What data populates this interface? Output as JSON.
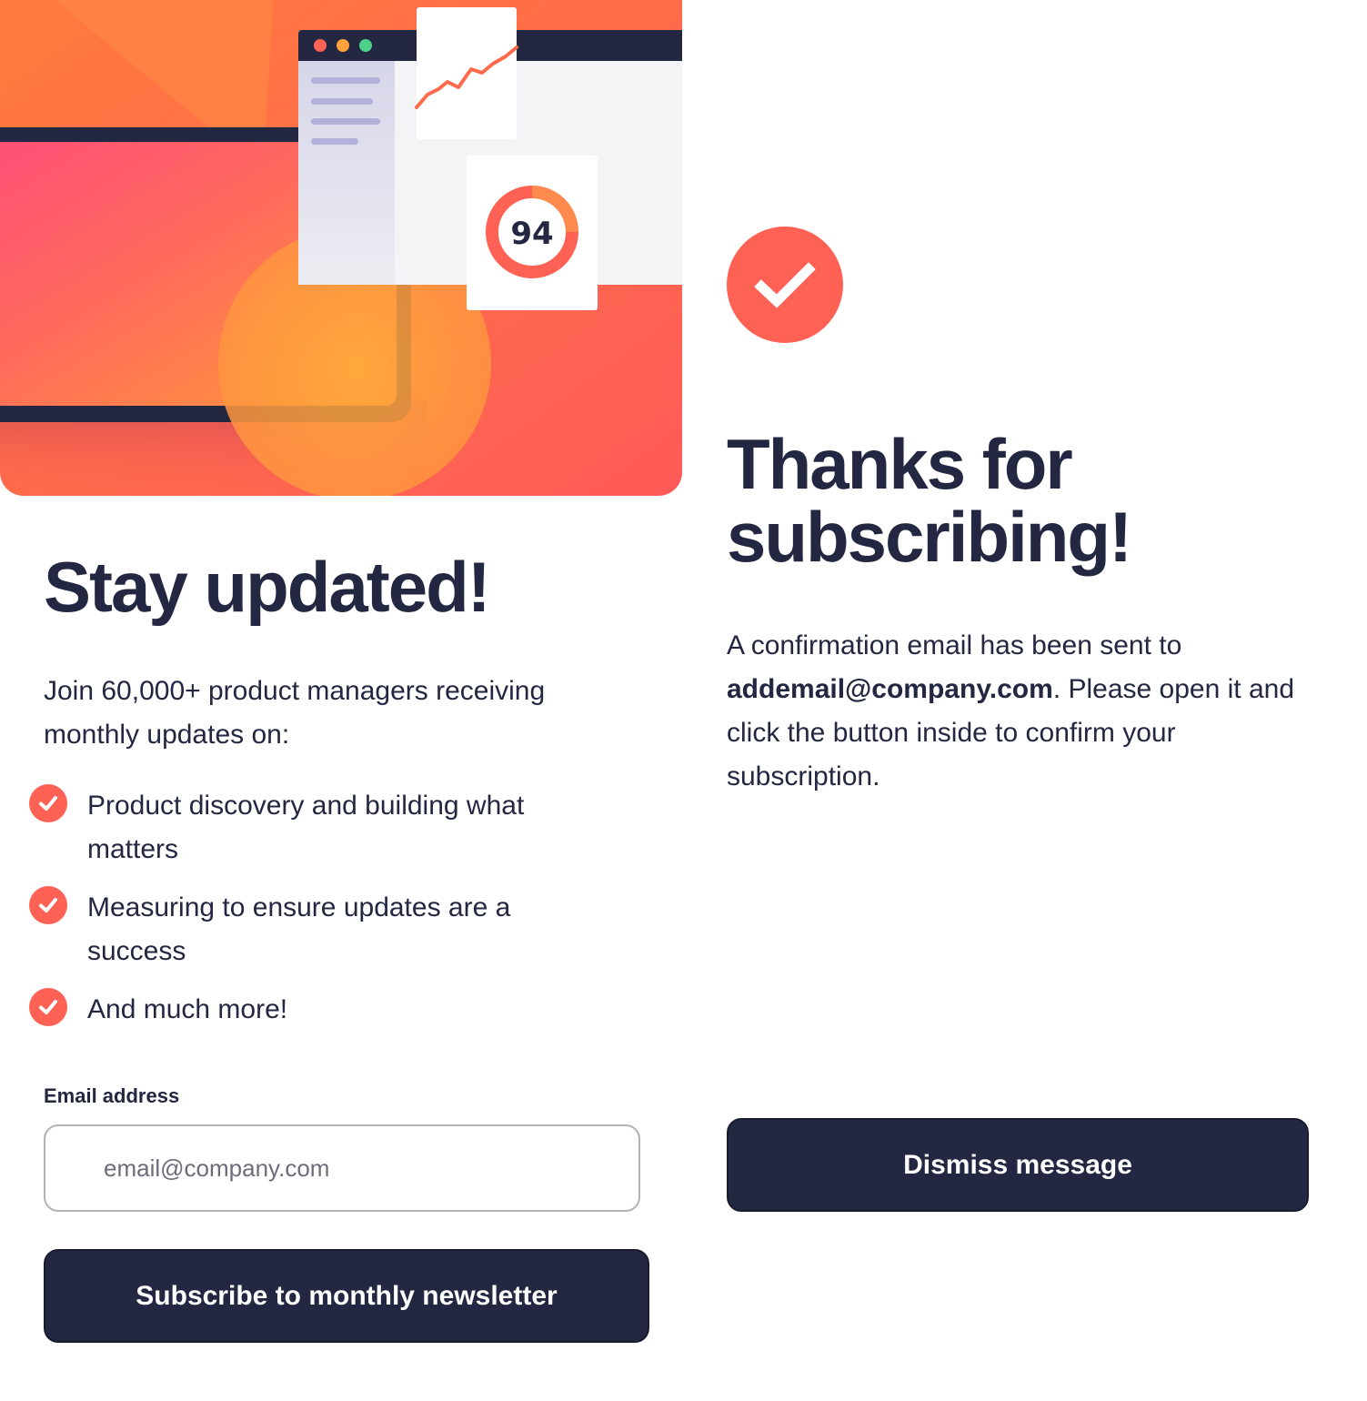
{
  "signup": {
    "hero_score": "94",
    "title": "Stay updated!",
    "intro": "Join 60,000+ product managers receiving monthly updates on:",
    "benefits": [
      {
        "text": "Product discovery and building what matters"
      },
      {
        "text": "Measuring to ensure updates are a success"
      },
      {
        "text": "And much more!"
      }
    ],
    "email_label": "Email address",
    "email_placeholder": "email@company.com",
    "email_value": "",
    "subscribe_label": "Subscribe to monthly newsletter"
  },
  "success": {
    "title": "Thanks for subscribing!",
    "text_before": "A confirmation email has been sent to ",
    "email": "addemail@company.com",
    "text_after": ". Please open it and click the button inside to confirm your subscription.",
    "dismiss_label": "Dismiss message"
  },
  "colors": {
    "accent": "#ff6155",
    "dark_navy": "#242742",
    "grey": "#9294a0",
    "white": "#ffffff"
  },
  "icons": {
    "bullet": "check-icon",
    "success": "check-icon"
  }
}
